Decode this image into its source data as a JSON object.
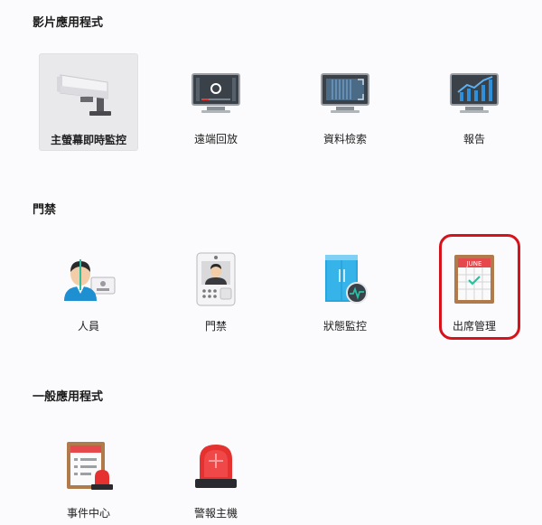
{
  "sections": [
    {
      "title": "影片應用程式",
      "items": [
        {
          "label": "主螢幕即時監控",
          "icon": "cctv-camera-icon",
          "active": true
        },
        {
          "label": "遠端回放",
          "icon": "playback-monitor-icon"
        },
        {
          "label": "資料檢索",
          "icon": "search-monitor-icon"
        },
        {
          "label": "報告",
          "icon": "report-chart-icon"
        }
      ]
    },
    {
      "title": "門禁",
      "items": [
        {
          "label": "人員",
          "icon": "person-id-icon"
        },
        {
          "label": "門禁",
          "icon": "door-intercom-icon"
        },
        {
          "label": "狀態監控",
          "icon": "door-status-icon"
        },
        {
          "label": "出席管理",
          "icon": "attendance-calendar-icon",
          "highlighted": true,
          "calendar_text": "JUNE"
        }
      ]
    },
    {
      "title": "一般應用程式",
      "items": [
        {
          "label": "事件中心",
          "icon": "event-center-icon"
        },
        {
          "label": "警報主機",
          "icon": "alarm-siren-icon"
        }
      ]
    }
  ],
  "colors": {
    "highlight": "#d8121a",
    "active_tile": "#e9e9ec",
    "monitor_screen": "#3a4149",
    "chart_blue": "#2f8fd8"
  }
}
